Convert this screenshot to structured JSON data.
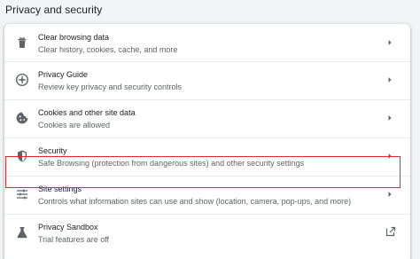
{
  "section": {
    "title": "Privacy and security"
  },
  "rows": [
    {
      "icon": "trash-icon",
      "title": "Clear browsing data",
      "subtitle": "Clear history, cookies, cache, and more",
      "action": "chevron-right-icon"
    },
    {
      "icon": "compass-icon",
      "title": "Privacy Guide",
      "subtitle": "Review key privacy and security controls",
      "action": "chevron-right-icon"
    },
    {
      "icon": "cookie-icon",
      "title": "Cookies and other site data",
      "subtitle": "Cookies are allowed",
      "action": "chevron-right-icon"
    },
    {
      "icon": "shield-icon",
      "title": "Security",
      "subtitle": "Safe Browsing (protection from dangerous sites) and other security settings",
      "action": "chevron-right-icon"
    },
    {
      "icon": "sliders-icon",
      "title": "Site settings",
      "subtitle": "Controls what information sites can use and show (location, camera, pop-ups, and more)",
      "action": "chevron-right-icon",
      "highlighted": true
    },
    {
      "icon": "flask-icon",
      "title": "Privacy Sandbox",
      "subtitle": "Trial features are off",
      "action": "open-in-new-icon"
    }
  ],
  "colors": {
    "background": "#f1f3f4",
    "card": "#ffffff",
    "icon": "#5f6368",
    "highlight_border": "#d93025"
  }
}
